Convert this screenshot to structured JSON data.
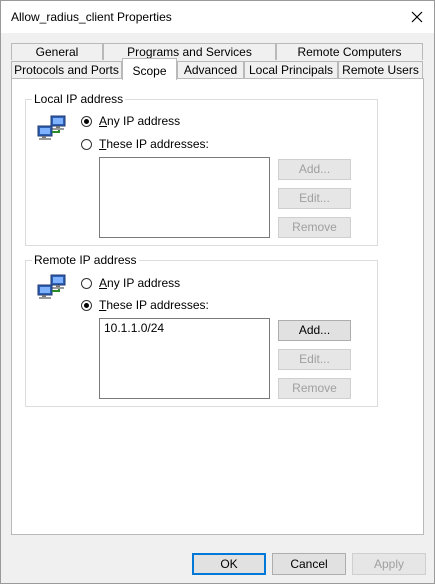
{
  "window": {
    "title": "Allow_radius_client Properties"
  },
  "tabs_top": [
    {
      "label": "General"
    },
    {
      "label": "Programs and Services"
    },
    {
      "label": "Remote Computers"
    }
  ],
  "tabs_bottom": [
    {
      "label": "Protocols and Ports"
    },
    {
      "label": "Scope"
    },
    {
      "label": "Advanced"
    },
    {
      "label": "Local Principals"
    },
    {
      "label": "Remote Users"
    }
  ],
  "local": {
    "group_title": "Local IP address",
    "any_label_u": "A",
    "any_label_rest": "ny IP address",
    "any_checked": true,
    "these_label_u": "T",
    "these_label_rest": "hese IP addresses:",
    "these_checked": false,
    "addresses": [],
    "add_label": "Add...",
    "edit_label": "Edit...",
    "remove_label": "Remove"
  },
  "remote": {
    "group_title": "Remote IP address",
    "any_label_u": "A",
    "any_label_rest": "ny IP address",
    "any_checked": false,
    "these_label_u": "T",
    "these_label_rest": "hese IP addresses:",
    "these_checked": true,
    "addresses": [
      "10.1.1.0/24"
    ],
    "add_label": "Add...",
    "edit_label": "Edit...",
    "remove_label": "Remove"
  },
  "footer": {
    "ok": "OK",
    "cancel": "Cancel",
    "apply": "Apply"
  },
  "icons": {
    "network": "network-computers-icon",
    "close": "close-icon"
  }
}
